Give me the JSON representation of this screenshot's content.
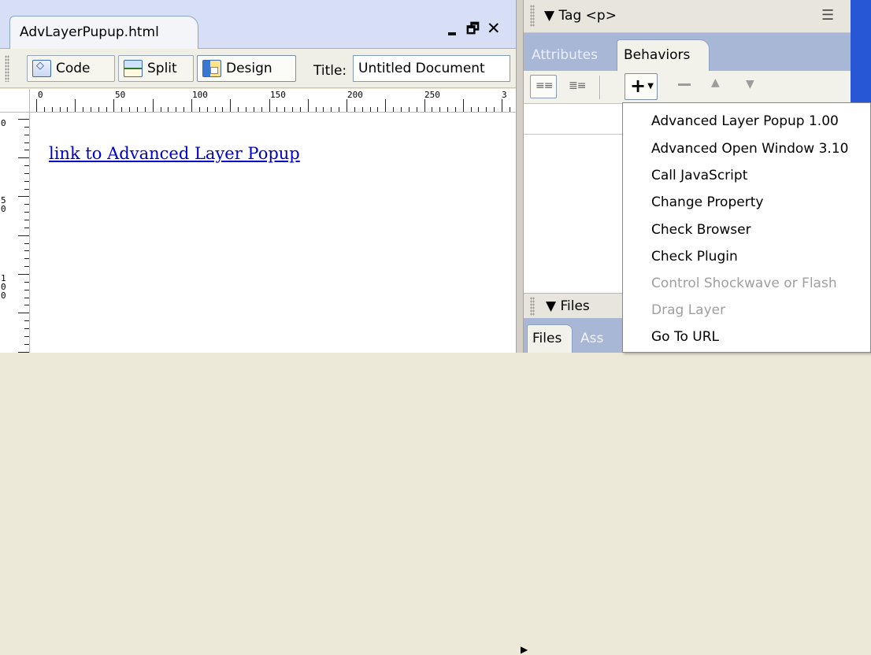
{
  "document": {
    "tab_title": "AdvLayerPupup.html",
    "window_controls": {
      "minimize": "_",
      "restore": "🗗",
      "close": "✕"
    },
    "toolbar": {
      "code_label": "Code",
      "split_label": "Split",
      "design_label": "Design",
      "title_label": "Title:",
      "title_value": "Untitled Document"
    },
    "ruler": {
      "horizontal": [
        "0",
        "50",
        "100",
        "150",
        "200",
        "250",
        "3"
      ],
      "vertical": [
        "0",
        "5\n0",
        "1\n0\n0"
      ]
    },
    "content": {
      "link_text": "link to Advanced Layer Popup"
    }
  },
  "tag_panel": {
    "title": "▼ Tag <p>",
    "options_icon": "☰",
    "tabs": {
      "attributes": "Attributes",
      "behaviors": "Behaviors"
    },
    "toolbar": {
      "add": "+",
      "remove": "—",
      "up": "▲",
      "down": "▼"
    }
  },
  "files_panel": {
    "title": "▼ Files",
    "tabs": {
      "files": "Files",
      "assets": "Ass"
    }
  },
  "add_menu": {
    "items": [
      {
        "label": "Advanced Layer Popup 1.00",
        "enabled": true
      },
      {
        "label": "Advanced Open Window 3.10",
        "enabled": true
      },
      {
        "label": "Call JavaScript",
        "enabled": true
      },
      {
        "label": "Change Property",
        "enabled": true
      },
      {
        "label": "Check Browser",
        "enabled": true
      },
      {
        "label": "Check Plugin",
        "enabled": true
      },
      {
        "label": "Control Shockwave or Flash",
        "enabled": false
      },
      {
        "label": "Drag Layer",
        "enabled": false
      },
      {
        "label": "Go To URL",
        "enabled": true
      }
    ]
  }
}
